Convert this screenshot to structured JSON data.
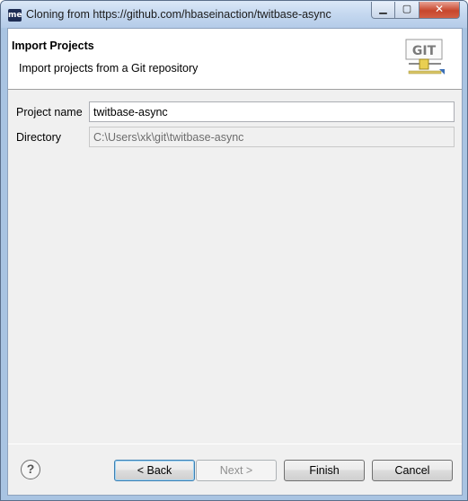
{
  "window": {
    "title": "Cloning from https://github.com/hbaseinaction/twitbase-async",
    "app_icon_text": "me",
    "min_glyph": "▁",
    "max_glyph": "▢",
    "close_glyph": "✕"
  },
  "header": {
    "title": "Import Projects",
    "description": "Import projects from a Git repository",
    "icon_text": "GIT"
  },
  "form": {
    "project_name_label": "Project name",
    "project_name_value": "twitbase-async",
    "directory_label": "Directory",
    "directory_value": "C:\\Users\\xk\\git\\twitbase-async"
  },
  "footer": {
    "help_glyph": "?",
    "back_label": "< Back",
    "next_label": "Next >",
    "finish_label": "Finish",
    "cancel_label": "Cancel"
  },
  "colors": {
    "title_bar": "#c6d9f0",
    "close_button": "#c7462c",
    "git_icon_accent": "#d4b63a"
  }
}
